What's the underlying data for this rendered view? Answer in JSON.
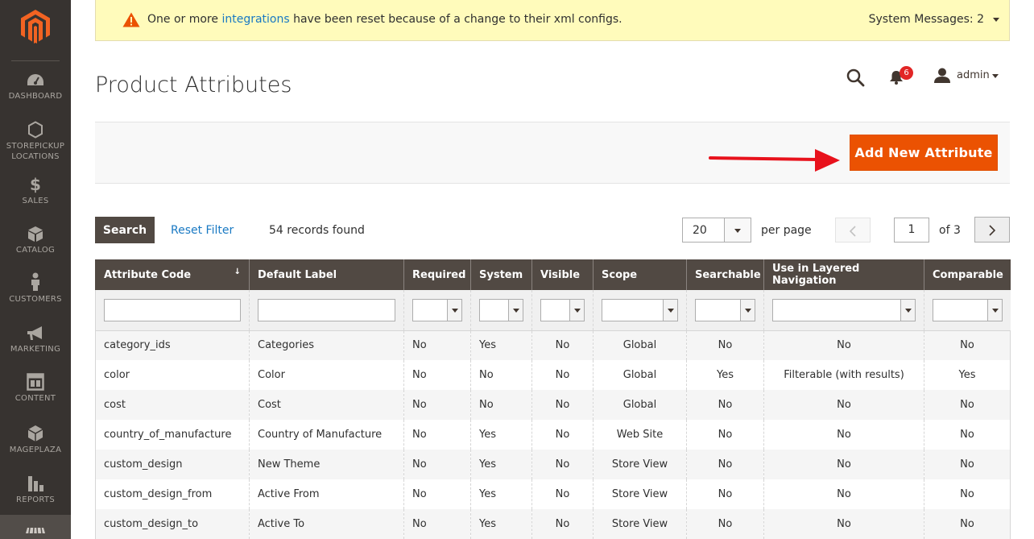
{
  "sidebar": {
    "items": [
      {
        "label": "DASHBOARD",
        "icon": "dashboard-icon"
      },
      {
        "label": "STOREPICKUP LOCATIONS",
        "line1": "STOREPICKUP",
        "line2": "LOCATIONS",
        "icon": "hexagon-icon"
      },
      {
        "label": "SALES",
        "icon": "dollar-icon"
      },
      {
        "label": "CATALOG",
        "icon": "box-icon"
      },
      {
        "label": "CUSTOMERS",
        "icon": "person-icon"
      },
      {
        "label": "MARKETING",
        "icon": "megaphone-icon"
      },
      {
        "label": "CONTENT",
        "icon": "layout-icon"
      },
      {
        "label": "MAGEPLAZA",
        "icon": "cube-icon"
      },
      {
        "label": "REPORTS",
        "icon": "bar-chart-icon"
      }
    ]
  },
  "banner": {
    "text_before": "One or more ",
    "link": "integrations",
    "text_after": " have been reset because of a change to their xml configs.",
    "system_messages": "System Messages: 2"
  },
  "header": {
    "title": "Product Attributes",
    "notifications_count": "6",
    "user": "admin"
  },
  "actions": {
    "add_new": "Add New Attribute"
  },
  "grid_controls": {
    "search": "Search",
    "reset_filter": "Reset Filter",
    "records_found": "54 records found",
    "per_page_value": "20",
    "per_page_label": "per page",
    "current_page": "1",
    "of_pages": "of 3"
  },
  "table": {
    "columns": [
      "Attribute Code",
      "Default Label",
      "Required",
      "System",
      "Visible",
      "Scope",
      "Searchable",
      "Use in Layered Navigation",
      "Comparable"
    ],
    "sort_indicator": "↓",
    "rows": [
      [
        "category_ids",
        "Categories",
        "No",
        "Yes",
        "No",
        "Global",
        "No",
        "No",
        "No"
      ],
      [
        "color",
        "Color",
        "No",
        "No",
        "No",
        "Global",
        "Yes",
        "Filterable (with results)",
        "Yes"
      ],
      [
        "cost",
        "Cost",
        "No",
        "No",
        "No",
        "Global",
        "No",
        "No",
        "No"
      ],
      [
        "country_of_manufacture",
        "Country of Manufacture",
        "No",
        "Yes",
        "No",
        "Web Site",
        "No",
        "No",
        "No"
      ],
      [
        "custom_design",
        "New Theme",
        "No",
        "Yes",
        "No",
        "Store View",
        "No",
        "No",
        "No"
      ],
      [
        "custom_design_from",
        "Active From",
        "No",
        "Yes",
        "No",
        "Store View",
        "No",
        "No",
        "No"
      ],
      [
        "custom_design_to",
        "Active To",
        "No",
        "Yes",
        "No",
        "Store View",
        "No",
        "No",
        "No"
      ]
    ]
  },
  "colors": {
    "accent": "#eb5202",
    "sidebar": "#373330",
    "header_row": "#514943",
    "link": "#1979c3"
  }
}
